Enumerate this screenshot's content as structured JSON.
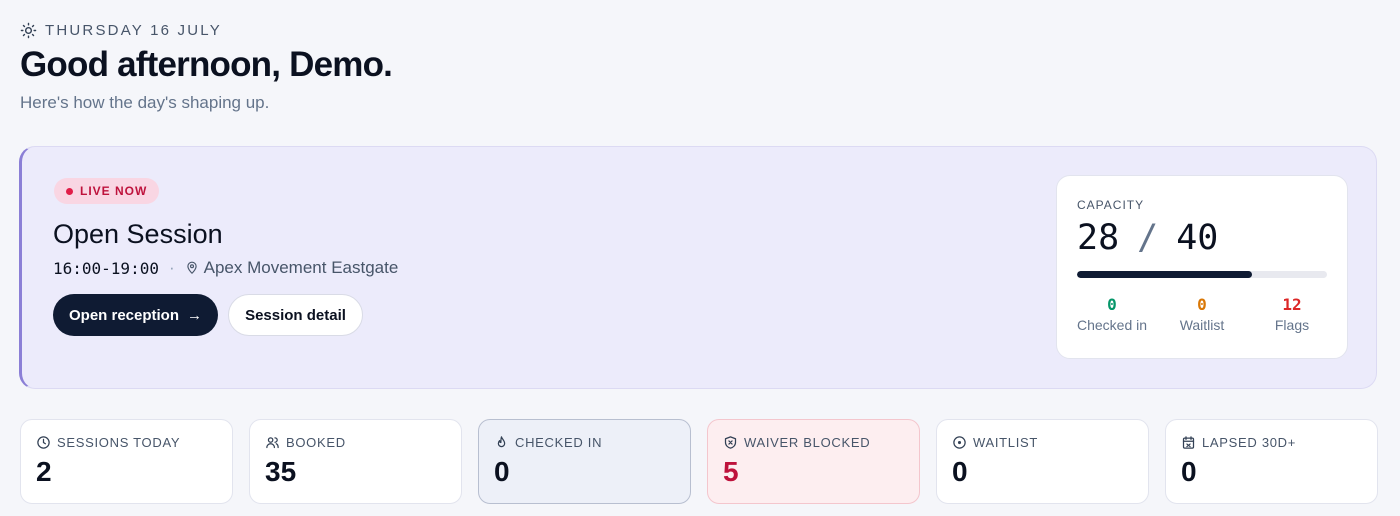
{
  "header": {
    "date": "THURSDAY 16 JULY",
    "greeting": "Good afternoon, Demo.",
    "subtitle": "Here's how the day's shaping up."
  },
  "live_session": {
    "badge": "LIVE NOW",
    "title": "Open Session",
    "time": "16:00-19:00",
    "separator": "·",
    "location": "Apex Movement Eastgate",
    "primary_button": "Open reception",
    "primary_button_arrow": "→",
    "secondary_button": "Session detail"
  },
  "capacity": {
    "label": "CAPACITY",
    "current": "28",
    "slash": "/",
    "total": "40",
    "fill_fraction": 0.7,
    "stats": [
      {
        "value": "0",
        "label": "Checked in",
        "color": "#059669"
      },
      {
        "value": "0",
        "label": "Waitlist",
        "color": "#d97706"
      },
      {
        "value": "12",
        "label": "Flags",
        "color": "#dc2626"
      }
    ]
  },
  "stat_cards": [
    {
      "label": "SESSIONS TODAY",
      "value": "2",
      "icon": "clock-icon"
    },
    {
      "label": "BOOKED",
      "value": "35",
      "icon": "users-icon"
    },
    {
      "label": "CHECKED IN",
      "value": "0",
      "icon": "flame-icon"
    },
    {
      "label": "WAIVER BLOCKED",
      "value": "5",
      "icon": "shield-x-icon"
    },
    {
      "label": "WAITLIST",
      "value": "0",
      "icon": "circle-dot-icon"
    },
    {
      "label": "LAPSED 30D+",
      "value": "0",
      "icon": "calendar-icon"
    }
  ]
}
